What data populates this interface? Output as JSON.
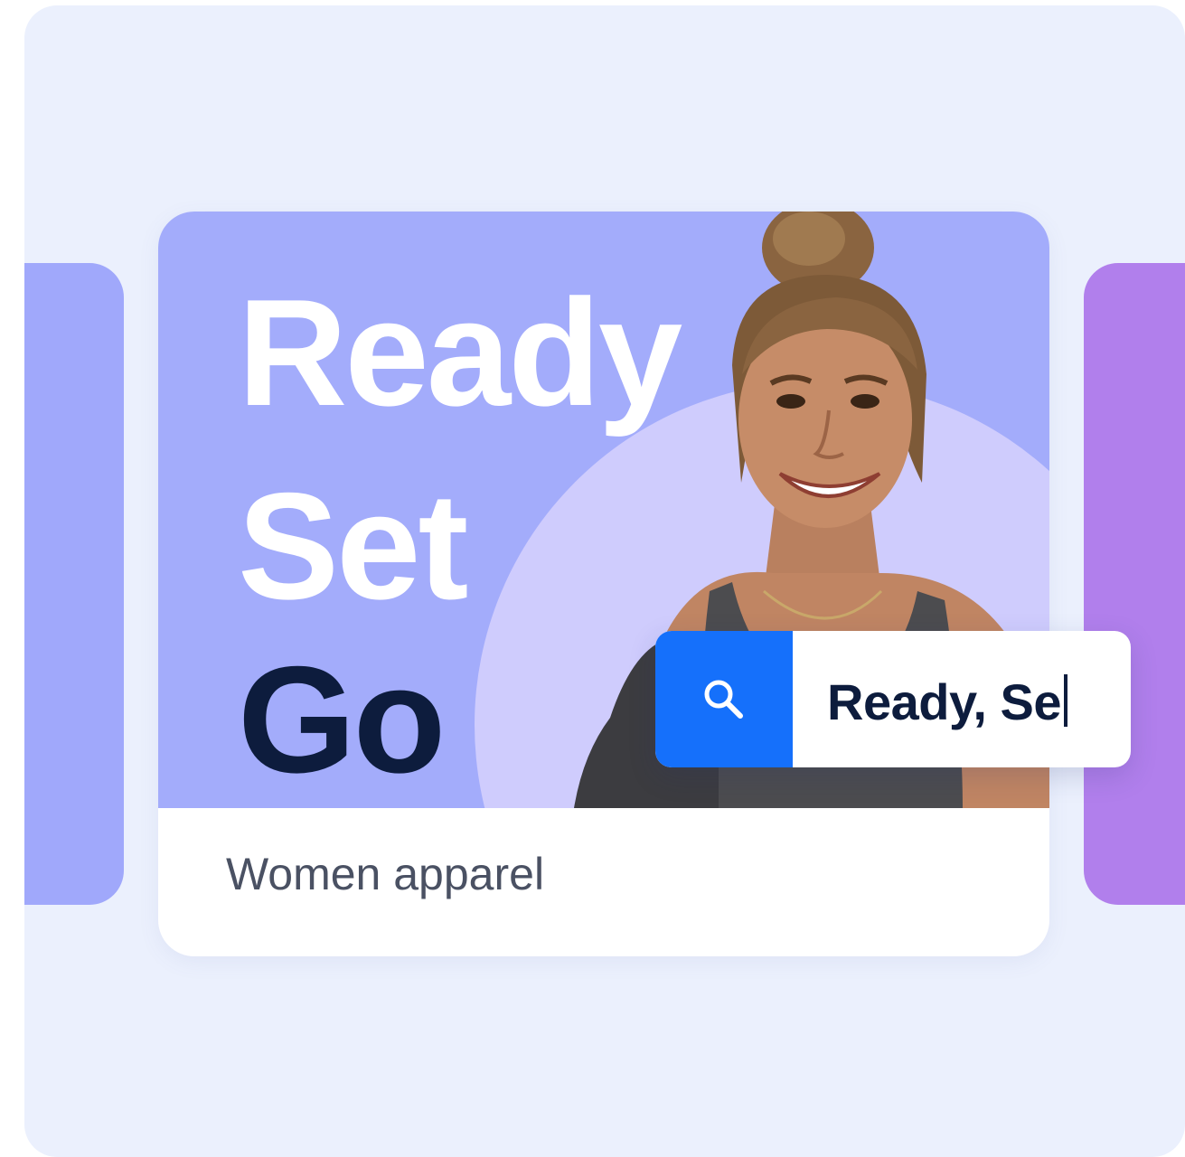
{
  "banner": {
    "line1": "Ready",
    "line2": "Set",
    "line3": "Go"
  },
  "card": {
    "caption": "Women apparel"
  },
  "search": {
    "value": "Ready, Se",
    "icon": "search-icon"
  },
  "colors": {
    "page_background": "#ebf0fd",
    "banner": "#a3acfb",
    "banner_circle": "#cfccfd",
    "left_card": "#a0a8fb",
    "right_card": "#b17fec",
    "search_button": "#1570fb",
    "dark_text": "#0d1c3d"
  }
}
